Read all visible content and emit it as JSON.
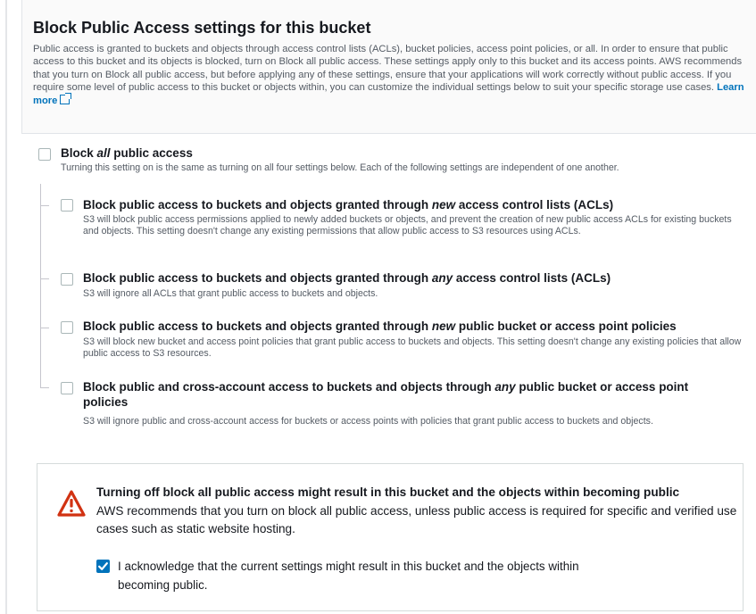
{
  "header": {
    "title": "Block Public Access settings for this bucket",
    "description": "Public access is granted to buckets and objects through access control lists (ACLs), bucket policies, access point policies, or all. In order to ensure that public access to this bucket and its objects is blocked, turn on Block all public access. These settings apply only to this bucket and its access points. AWS recommends that you turn on Block all public access, but before applying any of these settings, ensure that your applications will work correctly without public access. If you require some level of public access to this bucket or objects within, you can customize the individual settings below to suit your specific storage use cases.",
    "learn_more": "Learn more",
    "learn_more_icon": "external-link-icon"
  },
  "block_all": {
    "label_pre": "Block ",
    "label_em": "all",
    "label_post": " public access",
    "description": "Turning this setting on is the same as turning on all four settings below. Each of the following settings are independent of one another.",
    "checked": false
  },
  "options": [
    {
      "pre": "Block public access to buckets and objects granted through ",
      "em": "new",
      "post": " access control lists (ACLs)",
      "description": "S3 will block public access permissions applied to newly added buckets or objects, and prevent the creation of new public access ACLs for existing buckets and objects. This setting doesn't change any existing permissions that allow public access to S3 resources using ACLs.",
      "checked": false
    },
    {
      "pre": "Block public access to buckets and objects granted through ",
      "em": "any",
      "post": " access control lists (ACLs)",
      "description": "S3 will ignore all ACLs that grant public access to buckets and objects.",
      "checked": false
    },
    {
      "pre": "Block public access to buckets and objects granted through ",
      "em": "new",
      "post": " public bucket or access point policies",
      "description": "S3 will block new bucket and access point policies that grant public access to buckets and objects. This setting doesn't change any existing policies that allow public access to S3 resources.",
      "checked": false
    },
    {
      "pre": "Block public and cross-account access to buckets and objects through ",
      "em": "any",
      "post": " public bucket or access point policies",
      "description": "S3 will ignore public and cross-account access for buckets or access points with policies that grant public access to buckets and objects.",
      "checked": false
    }
  ],
  "warning": {
    "icon": "warning-icon",
    "title": "Turning off block all public access might result in this bucket and the objects within becoming public",
    "description": "AWS recommends that you turn on block all public access, unless public access is required for specific and verified use cases such as static website hosting.",
    "acknowledge_label": "I acknowledge that the current settings might result in this bucket and the objects within becoming public.",
    "acknowledge_checked": true
  },
  "colors": {
    "link": "#0073bb",
    "warning_red": "#d13212",
    "checkbox_checked": "#0073bb"
  }
}
